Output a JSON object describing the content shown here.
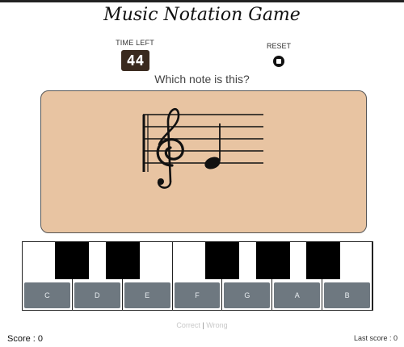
{
  "game": {
    "title": "Music Notation Game",
    "time_left_label": "TIME LEFT",
    "time_left_value": "44",
    "reset_label": "RESET",
    "question": "Which note is this?"
  },
  "staff": {
    "clef": "treble-clef",
    "note": "quarter-note",
    "note_position": "first-line-E"
  },
  "piano": {
    "white_keys": [
      {
        "label": "C"
      },
      {
        "label": "D"
      },
      {
        "label": "E"
      },
      {
        "label": "F"
      },
      {
        "label": "G"
      },
      {
        "label": "A"
      },
      {
        "label": "B"
      }
    ],
    "black_keys": [
      "C#",
      "D#",
      "F#",
      "G#",
      "A#"
    ]
  },
  "feedback": {
    "correct": "Correct",
    "separator": "|",
    "wrong": "Wrong"
  },
  "score": {
    "current": "Score : 0",
    "last": "Last score : 0"
  },
  "colors": {
    "card_bg": "#e8c4a2",
    "timer_bg": "#3a2a1e",
    "key_label_bg": "#6e7880"
  }
}
